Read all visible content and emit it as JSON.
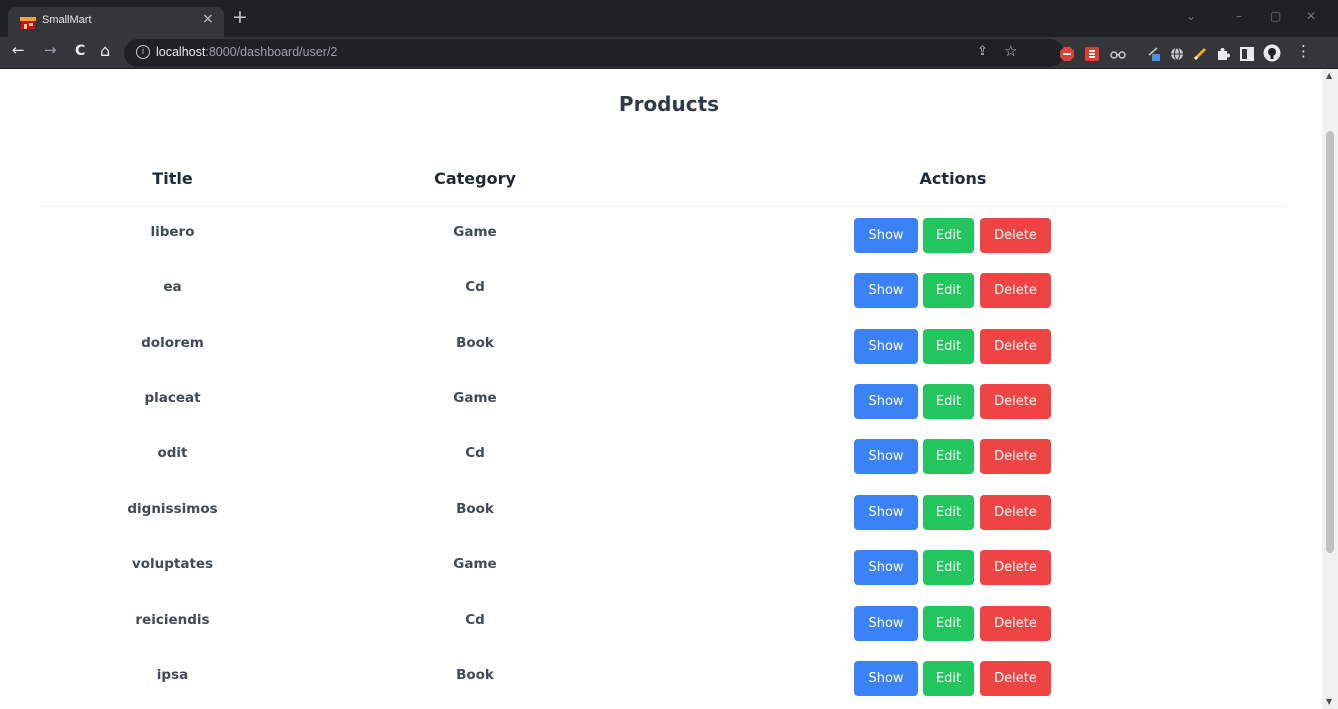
{
  "browser": {
    "tab_title": "SmallMart",
    "tab_close": "×",
    "new_tab": "+",
    "url_host": "localhost",
    "url_path": ":8000/dashboard/user/2",
    "back_glyph": "←",
    "forward_glyph": "→",
    "reload_glyph": "C",
    "home_glyph": "⌂",
    "star_glyph": "☆",
    "share_glyph": "⇪",
    "menu_glyph": "⋮",
    "window_min": "–",
    "window_max": "▢",
    "window_close": "✕",
    "window_chevron": "⌄"
  },
  "page": {
    "title": "Products",
    "columns": {
      "title": "Title",
      "category": "Category",
      "actions": "Actions"
    },
    "buttons": {
      "show": "Show",
      "edit": "Edit",
      "delete": "Delete"
    },
    "rows": [
      {
        "title": "libero",
        "category": "Game"
      },
      {
        "title": "ea",
        "category": "Cd"
      },
      {
        "title": "dolorem",
        "category": "Book"
      },
      {
        "title": "placeat",
        "category": "Game"
      },
      {
        "title": "odit",
        "category": "Cd"
      },
      {
        "title": "dignissimos",
        "category": "Book"
      },
      {
        "title": "voluptates",
        "category": "Game"
      },
      {
        "title": "reiciendis",
        "category": "Cd"
      },
      {
        "title": "ipsa",
        "category": "Book"
      }
    ]
  },
  "colors": {
    "show": "#3b82f6",
    "edit": "#22c55e",
    "delete": "#ef4444",
    "heading": "#2f3b4c",
    "chrome_dark": "#202124",
    "chrome_toolbar": "#35363a"
  },
  "icons": {
    "extensions": [
      "abp-icon",
      "s-extension-icon",
      "glasses-icon",
      "pen-tool-icon",
      "globe-icon",
      "pencil-icon",
      "puzzle-icon",
      "side-panel-icon",
      "profile-avatar-icon"
    ]
  }
}
